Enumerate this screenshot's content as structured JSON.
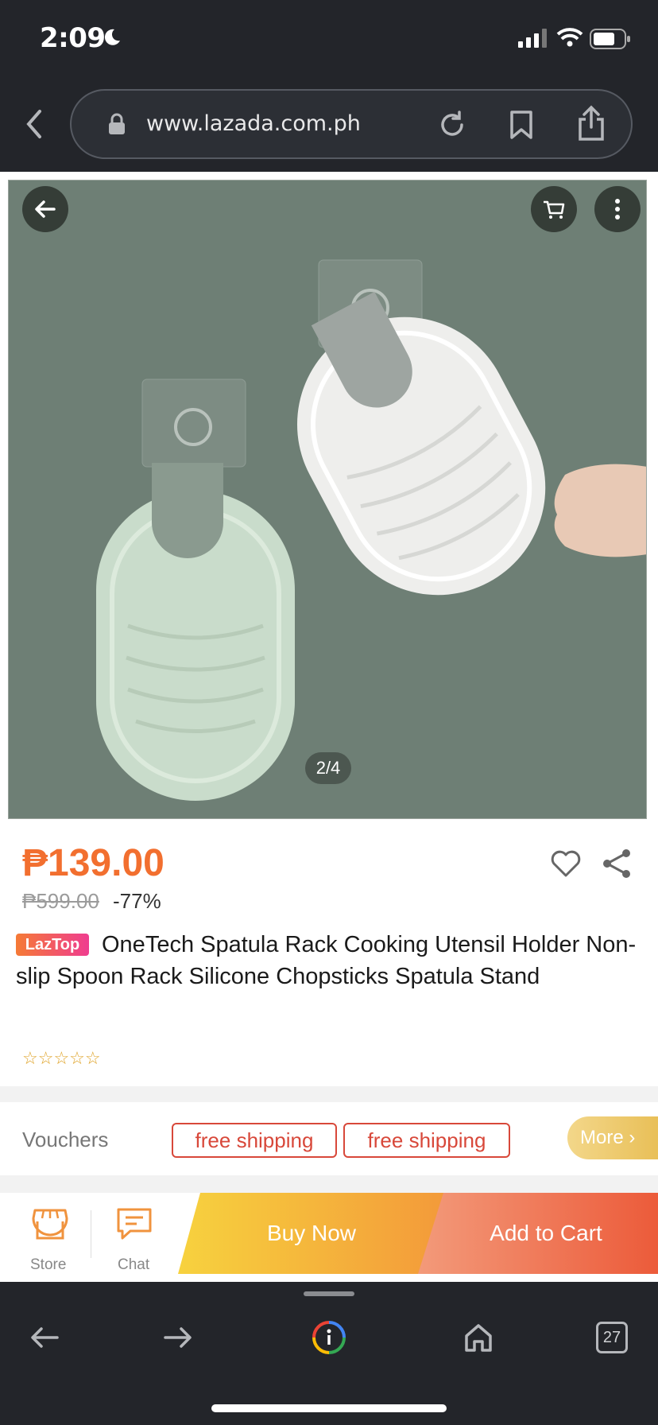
{
  "status_bar": {
    "time": "2:09"
  },
  "browser": {
    "url": "www.lazada.com.ph",
    "tab_count": "27"
  },
  "product": {
    "image_counter": "2/4",
    "price": "₱139.00",
    "original_price": "₱599.00",
    "discount": "-77%",
    "badge": "LazTop",
    "title": "OneTech Spatula Rack Cooking Utensil Holder Non-slip Spoon Rack Silicone Chopsticks Spatula Stand",
    "rating_stars": "☆☆☆☆☆"
  },
  "vouchers": {
    "label": "Vouchers",
    "tags": [
      "free shipping",
      "free shipping"
    ],
    "more": "More ›"
  },
  "actions": {
    "store": "Store",
    "chat": "Chat",
    "buy_now": "Buy Now",
    "add_to_cart": "Add to Cart"
  },
  "colors": {
    "price": "#f26f2f",
    "voucher": "#d8483a",
    "buy_now_start": "#f7d23e",
    "add_cart_end": "#ec5b3a"
  }
}
